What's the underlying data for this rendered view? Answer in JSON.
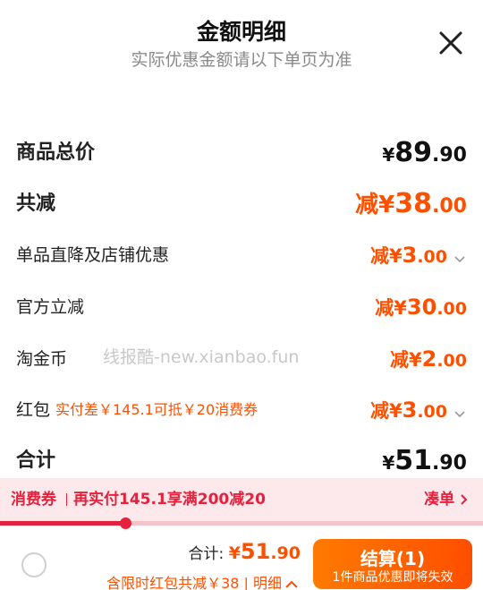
{
  "header": {
    "title": "金额明细",
    "subtitle": "实际优惠金额请以下单页为准"
  },
  "rows": {
    "total_price": {
      "label": "商品总价",
      "yen": "¥",
      "int": "89",
      "dec": ".90"
    },
    "total_reduce": {
      "label": "共减",
      "prefix": "减¥",
      "int": "38",
      "dec": ".00"
    },
    "shop_discount": {
      "label": "单品直降及店铺优惠",
      "prefix": "减¥",
      "int": "3",
      "dec": ".00"
    },
    "official": {
      "label": "官方立减",
      "prefix": "减¥",
      "int": "30",
      "dec": ".00"
    },
    "taojinbi": {
      "label": "淘金币",
      "prefix": "减¥",
      "int": "2",
      "dec": ".00"
    },
    "hongbao": {
      "label": "红包",
      "note": "实付差￥145.1可抵￥20消费券",
      "prefix": "减¥",
      "int": "3",
      "dec": ".00"
    },
    "sum": {
      "label": "合计",
      "yen": "¥",
      "int": "51",
      "dec": ".90"
    }
  },
  "watermark": "线报酷-new.xianbao.fun",
  "coupon": {
    "tag": "消费券",
    "text": "再实付145.1享满200减20",
    "link": "凑单",
    "progress": 0.26
  },
  "footer": {
    "total_label": "合计: ",
    "total_yen": "¥",
    "total_int": "51",
    "total_dec": ".90",
    "summary": "含限时红包共减￥38 | 明细",
    "checkout_label": "结算(1)",
    "checkout_sub": "1件商品优惠即将失效"
  },
  "colors": {
    "accent_orange": "#ff5000",
    "coupon_red": "#e5213d",
    "coupon_bg": "#fde8ec"
  },
  "icons": [
    "close-icon",
    "chevron-down-icon",
    "chevron-right-icon",
    "chevron-up-icon"
  ]
}
